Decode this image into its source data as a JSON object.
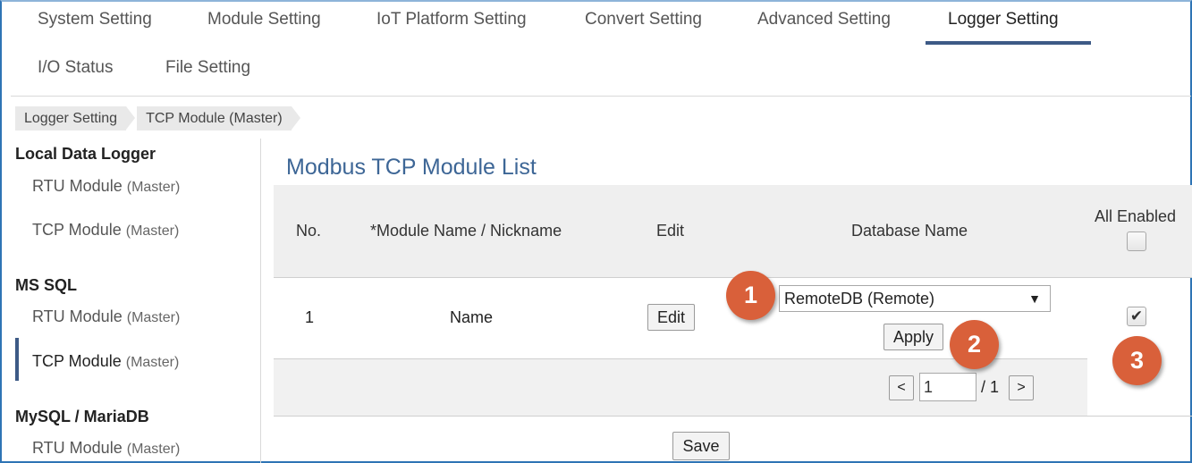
{
  "tabs": {
    "row1": [
      "System Setting",
      "Module Setting",
      "IoT Platform Setting",
      "Convert Setting",
      "Advanced Setting",
      "Logger Setting"
    ],
    "row2": [
      "I/O Status",
      "File Setting"
    ],
    "active": "Logger Setting"
  },
  "breadcrumb": [
    "Logger Setting",
    "TCP Module (Master)"
  ],
  "sidebar": {
    "groups": [
      {
        "title": "Local Data Logger",
        "items": [
          {
            "label": "RTU Module",
            "sub": "(Master)"
          },
          {
            "label": "TCP Module",
            "sub": "(Master)"
          }
        ]
      },
      {
        "title": "MS SQL",
        "items": [
          {
            "label": "RTU Module",
            "sub": "(Master)"
          },
          {
            "label": "TCP Module",
            "sub": "(Master)",
            "active": true
          }
        ]
      },
      {
        "title": "MySQL / MariaDB",
        "items": [
          {
            "label": "RTU Module",
            "sub": "(Master)"
          }
        ]
      }
    ]
  },
  "main": {
    "title": "Modbus TCP Module List",
    "columns": {
      "no": "No.",
      "name": "*Module Name / Nickname",
      "edit": "Edit",
      "database": "Database Name",
      "all_enabled": "All Enabled"
    },
    "rows": [
      {
        "no": "1",
        "name": "Name",
        "edit_label": "Edit",
        "database": "RemoteDB (Remote)",
        "enabled": true
      }
    ],
    "apply_label": "Apply",
    "pager": {
      "prev": "<",
      "page": "1",
      "total": "/ 1",
      "next": ">"
    },
    "save_label": "Save"
  },
  "annotations": [
    "1",
    "2",
    "3"
  ],
  "colors": {
    "accent": "#3d5a86",
    "title": "#3d6696",
    "badge": "#d9603a"
  }
}
